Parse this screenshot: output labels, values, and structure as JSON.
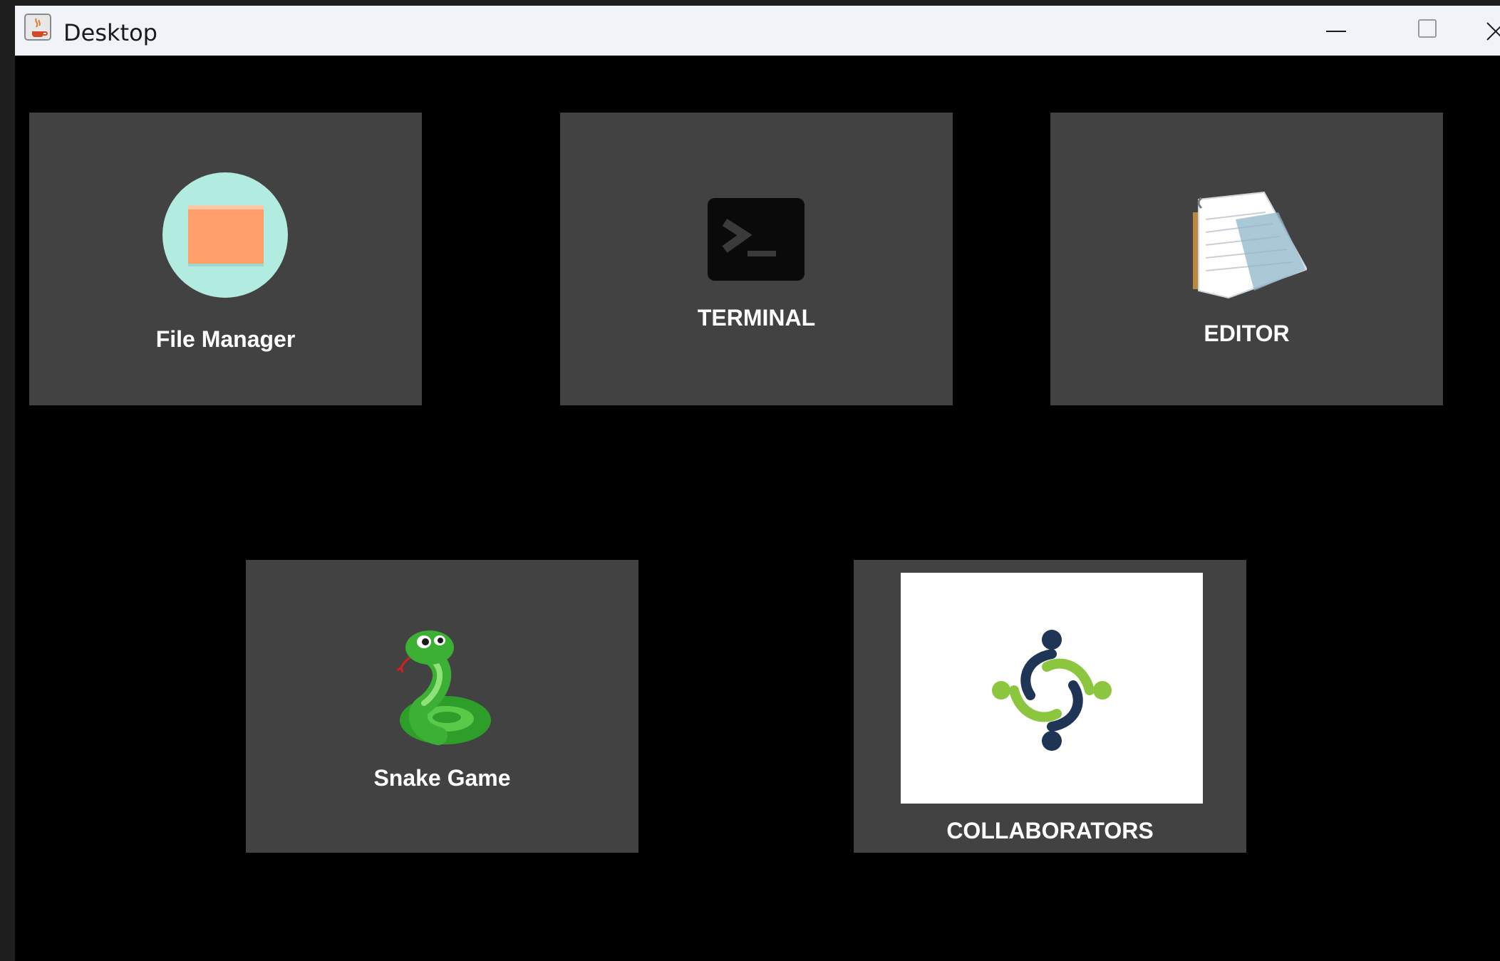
{
  "window": {
    "title": "Desktop",
    "controls": {
      "minimize_icon": "minimize-icon",
      "maximize_icon": "maximize-icon",
      "close_icon": "close-icon"
    }
  },
  "colors": {
    "background": "#000000",
    "tile": "#424242",
    "titlebar": "#f0f4f9",
    "label": "#ffffff"
  },
  "apps": [
    {
      "label": "File Manager",
      "icon": "folder-icon"
    },
    {
      "label": "TERMINAL",
      "icon": "terminal-icon"
    },
    {
      "label": "EDITOR",
      "icon": "notepad-icon"
    },
    {
      "label": "Snake Game",
      "icon": "snake-icon"
    },
    {
      "label": "COLLABORATORS",
      "icon": "collaborators-icon"
    }
  ]
}
